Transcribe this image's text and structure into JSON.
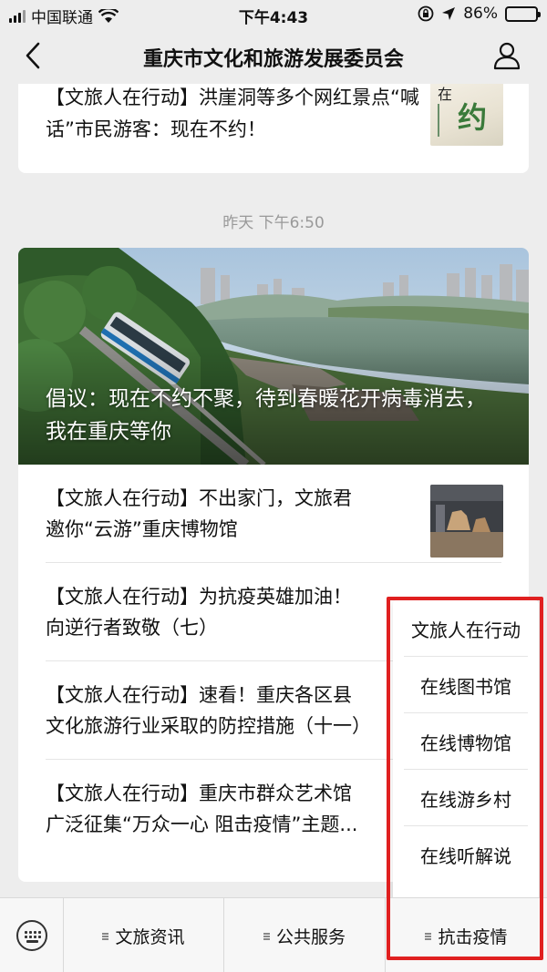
{
  "status_bar": {
    "carrier": "中国联通",
    "time": "下午4:43",
    "battery_text": "86%",
    "battery_level": 0.86,
    "icons": [
      "signal-icon",
      "wifi-icon",
      "lock-rotation-icon",
      "location-icon",
      "battery-icon"
    ]
  },
  "nav": {
    "title": "重庆市文化和旅游发展委员会",
    "back_icon": "chevron-left-icon",
    "profile_icon": "user-icon"
  },
  "top_article": {
    "title": "【文旅人在行动】洪崖洞等多个网红景点“喊话”市民游客：现在不约！"
  },
  "timestamp": "昨天 下午6:50",
  "main_article": {
    "title": "倡议：现在不约不聚，待到春暖花开病毒消去，我在重庆等你"
  },
  "articles": [
    {
      "title_line1": "【文旅人在行动】不出家门，文旅君",
      "title_line2": "邀你“云游”重庆博物馆"
    },
    {
      "title_line1": "【文旅人在行动】为抗疫英雄加油！",
      "title_line2": "向逆行者致敬（七）"
    },
    {
      "title_line1": "【文旅人在行动】速看！重庆各区县",
      "title_line2": "文化旅游行业采取的防控措施（十一）"
    },
    {
      "title_line1": "【文旅人在行动】重庆市群众艺术馆",
      "title_line2": "广泛征集“万众一心 阻击疫情”主题..."
    }
  ],
  "popup_menu": {
    "items": [
      "文旅人在行动",
      "在线图书馆",
      "在线博物馆",
      "在线游乡村",
      "在线听解说"
    ]
  },
  "bottom_menu": {
    "keyboard_icon": "keyboard-icon",
    "items": [
      "文旅资讯",
      "公共服务",
      "抗击疫情"
    ]
  },
  "colors": {
    "background": "#ededed",
    "highlight": "#e02020",
    "battery": "#2fc45a"
  }
}
